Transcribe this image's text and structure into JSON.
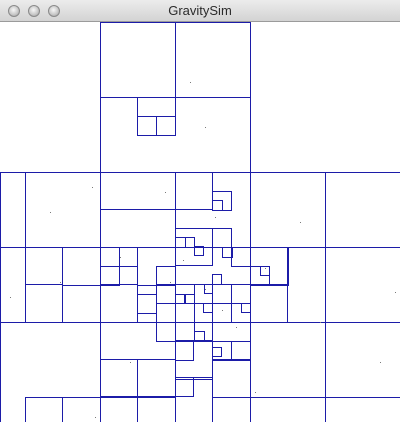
{
  "window": {
    "title": "GravitySim",
    "controls": [
      "close",
      "minimize",
      "zoom"
    ]
  },
  "canvas": {
    "background_color": "#ffffff",
    "grid_color": "#1c1ca8",
    "particle_color": "#7a7a7a"
  }
}
